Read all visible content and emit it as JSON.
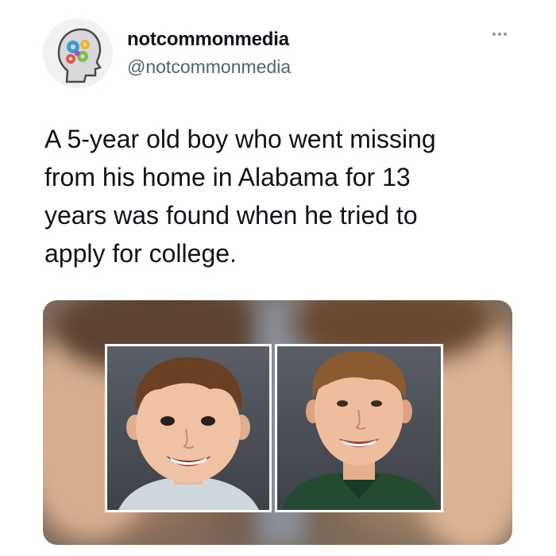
{
  "author": {
    "display_name": "notcommonmedia",
    "handle": "@notcommonmedia",
    "avatar_icon": "brain-gears-logo-icon"
  },
  "more_icon": "more-dots-icon",
  "tweet": {
    "text_lines": [
      "A 5-year old boy who went missing",
      "from his home in Alabama for 13",
      "years was found when he tried to",
      "apply for college."
    ]
  },
  "media": {
    "description_icon": "photo-image",
    "panels": [
      "child-photo",
      "teen-photo"
    ]
  }
}
